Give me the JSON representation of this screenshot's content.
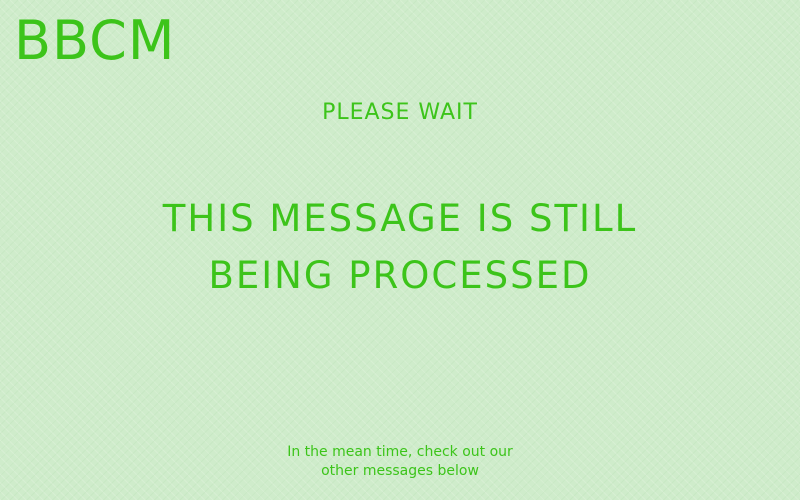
{
  "logo": {
    "text": "BBCM"
  },
  "status": {
    "label": "PLEASE WAIT"
  },
  "message": {
    "line1": "THIS MESSAGE IS STILL",
    "line2": "BEING PROCESSED"
  },
  "footer": {
    "line1": "In the mean time, check out our",
    "line2": "other messages below"
  },
  "colors": {
    "accent": "#3cc41a",
    "background": "#cfeccb"
  }
}
